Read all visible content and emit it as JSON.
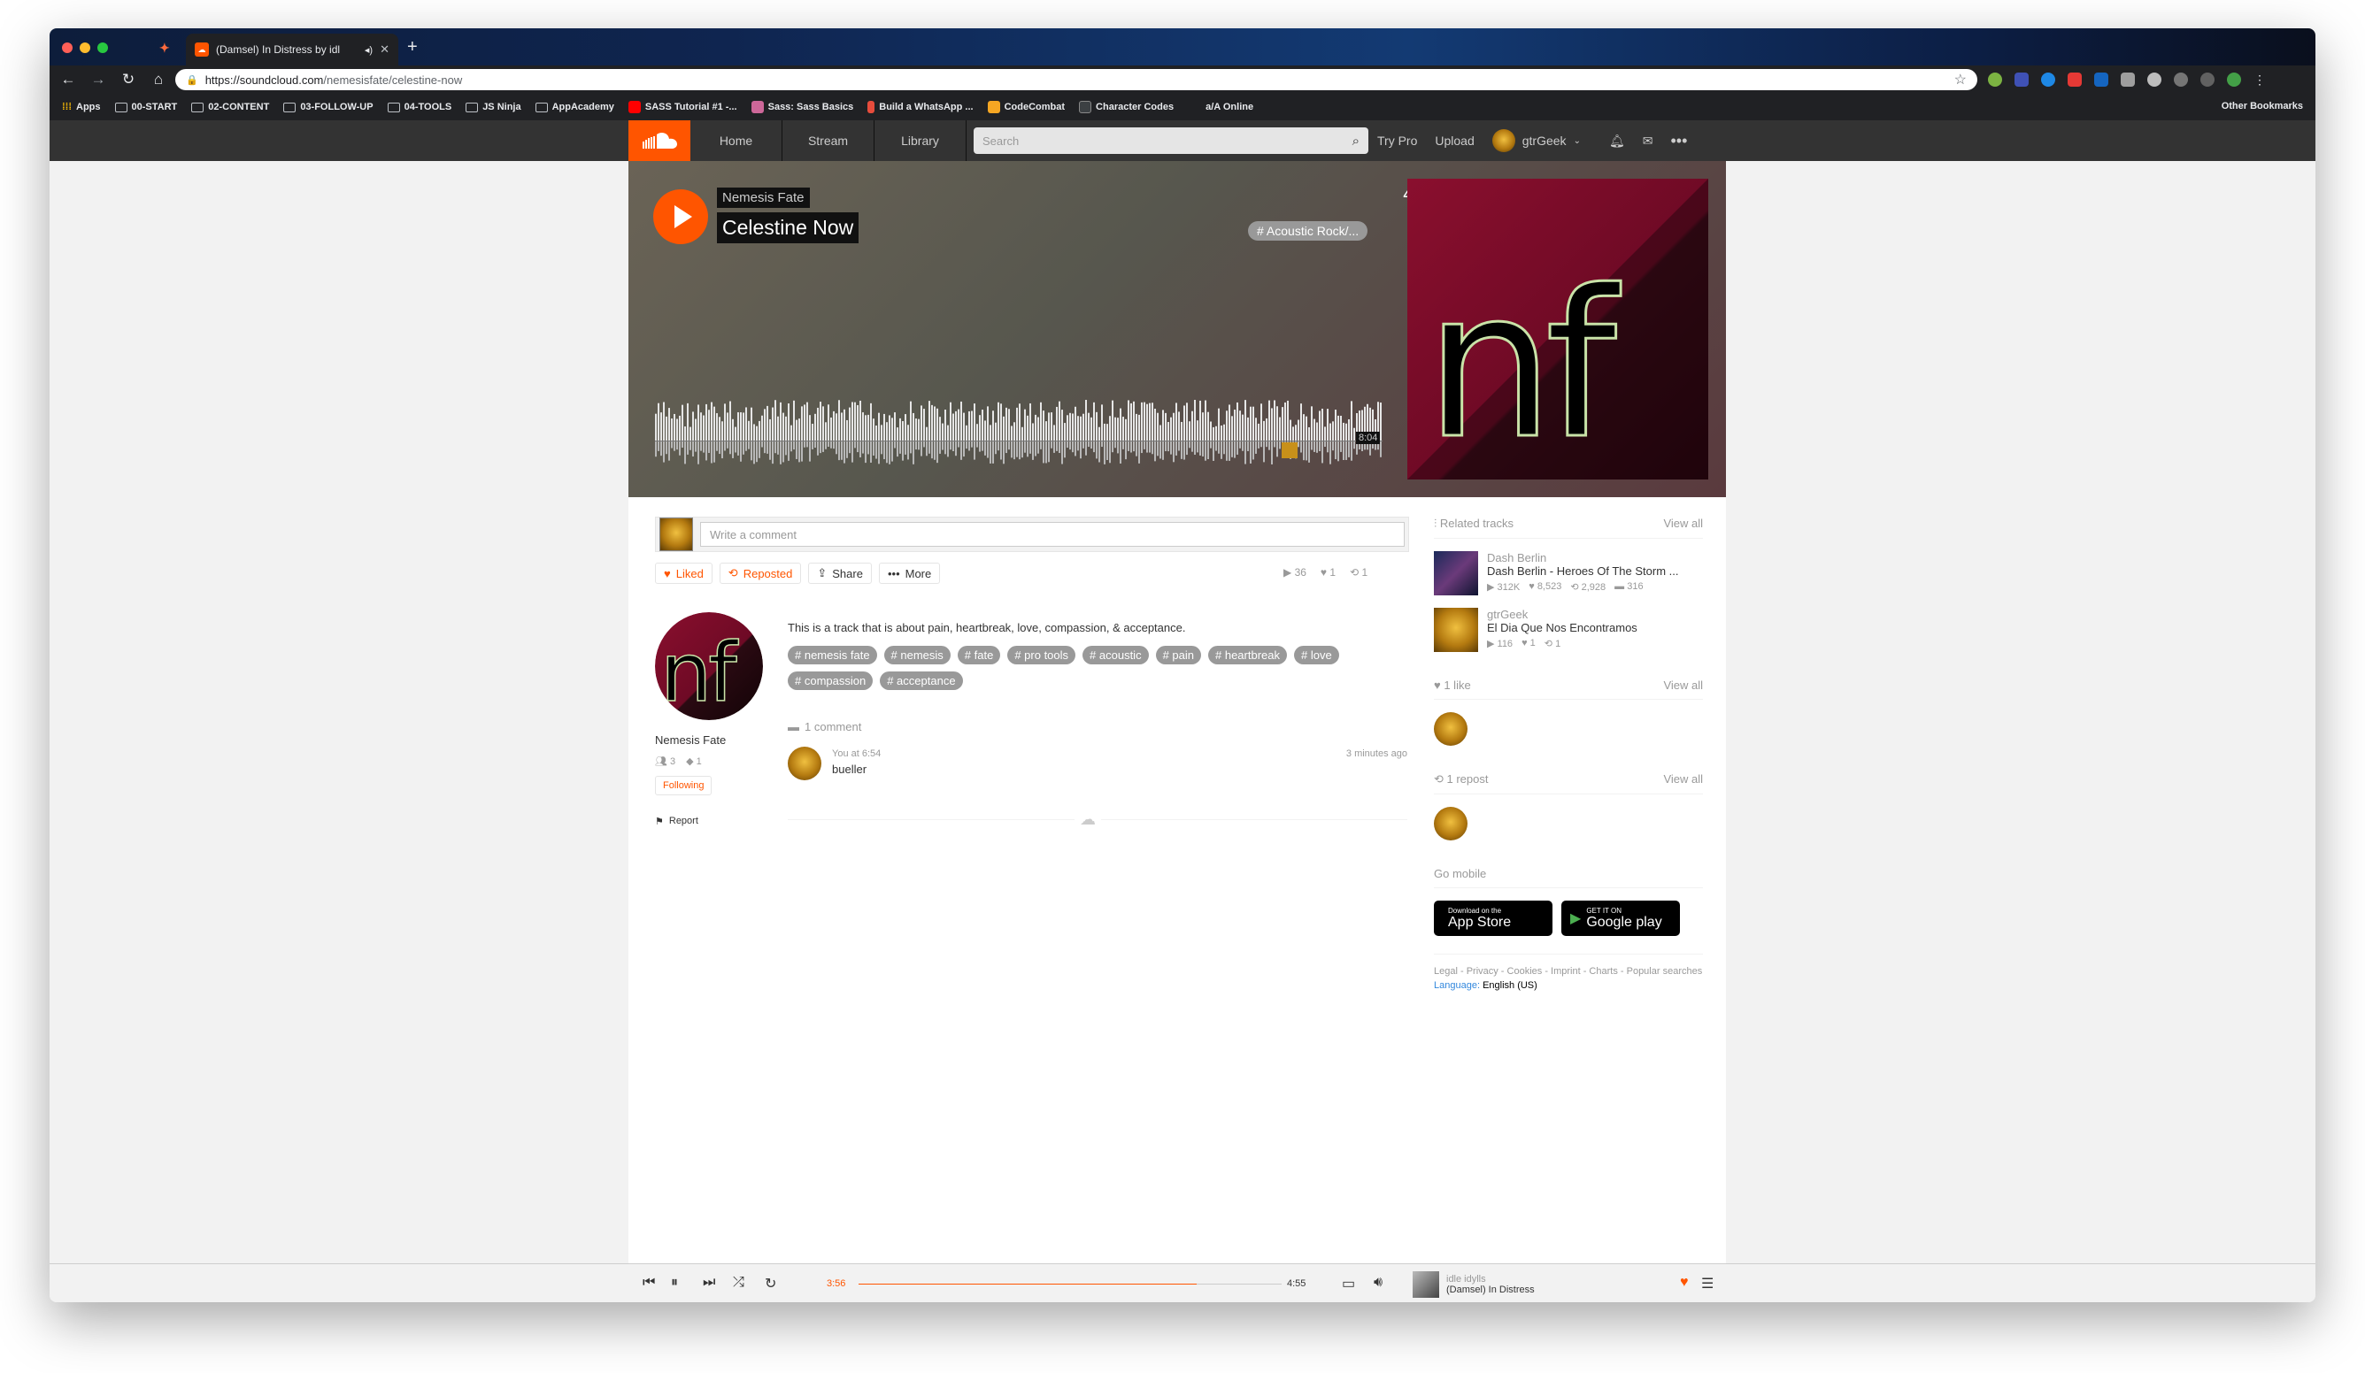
{
  "browser": {
    "tab_title": "(Damsel) In Distress by idl",
    "url_host": "https://soundcloud.com",
    "url_path": "/nemesisfate/celestine-now",
    "bookmarks": [
      "Apps",
      "00-START",
      "02-CONTENT",
      "03-FOLLOW-UP",
      "04-TOOLS",
      "JS Ninja",
      "AppAcademy",
      "SASS Tutorial #1 -...",
      "Sass: Sass Basics",
      "Build a WhatsApp ...",
      "CodeCombat",
      "Character Codes",
      "a/A Online"
    ],
    "other_bookmarks": "Other Bookmarks"
  },
  "header": {
    "nav": [
      "Home",
      "Stream",
      "Library"
    ],
    "search_placeholder": "Search",
    "try_pro": "Try Pro",
    "upload": "Upload",
    "username": "gtrGeek"
  },
  "hero": {
    "artist": "Nemesis Fate",
    "title": "Celestine Now",
    "posted": "4 years ago",
    "genre": "# Acoustic Rock/...",
    "duration": "8:04"
  },
  "comment_input_placeholder": "Write a comment",
  "actions": {
    "liked": "Liked",
    "reposted": "Reposted",
    "share": "Share",
    "more": "More"
  },
  "stats": {
    "plays": "36",
    "likes": "1",
    "reposts": "1"
  },
  "artist": {
    "name": "Nemesis Fate",
    "followers": "3",
    "tracks": "1",
    "follow_state": "Following",
    "report": "Report"
  },
  "description": "This is a track that is about pain, heartbreak, love, compassion, & acceptance.",
  "tags": [
    "# nemesis fate",
    "# nemesis",
    "# fate",
    "# pro tools",
    "# acoustic",
    "# pain",
    "# heartbreak",
    "# love",
    "# compassion",
    "# acceptance"
  ],
  "comment_count": "1 comment",
  "comment": {
    "user": "You",
    "at": "at",
    "timestamp": "6:54",
    "text": "bueller",
    "posted": "3 minutes ago"
  },
  "sidebar": {
    "related_title": "Related tracks",
    "view_all": "View all",
    "related": [
      {
        "user": "Dash Berlin",
        "title": "Dash Berlin - Heroes Of The Storm ...",
        "plays": "312K",
        "likes": "8,523",
        "reposts": "2,928",
        "comments": "316"
      },
      {
        "user": "gtrGeek",
        "title": "El Dia Que Nos Encontramos",
        "plays": "116",
        "likes": "1",
        "reposts": "1",
        "comments": ""
      }
    ],
    "likes_title": "1 like",
    "reposts_title": "1 repost",
    "go_mobile": "Go mobile",
    "app_store_small": "Download on the",
    "app_store_big": "App Store",
    "google_small": "GET IT ON",
    "google_big": "Google play",
    "footer": "Legal - Privacy - Cookies - Imprint - Charts - Popular searches",
    "language_key": "Language:",
    "language_val": "English (US)"
  },
  "player": {
    "elapsed": "3:56",
    "total": "4:55",
    "progress": 0.8,
    "artist": "idle idylls",
    "title": "(Damsel) In Distress"
  },
  "colors": {
    "accent": "#ff5500",
    "header": "#333333"
  }
}
